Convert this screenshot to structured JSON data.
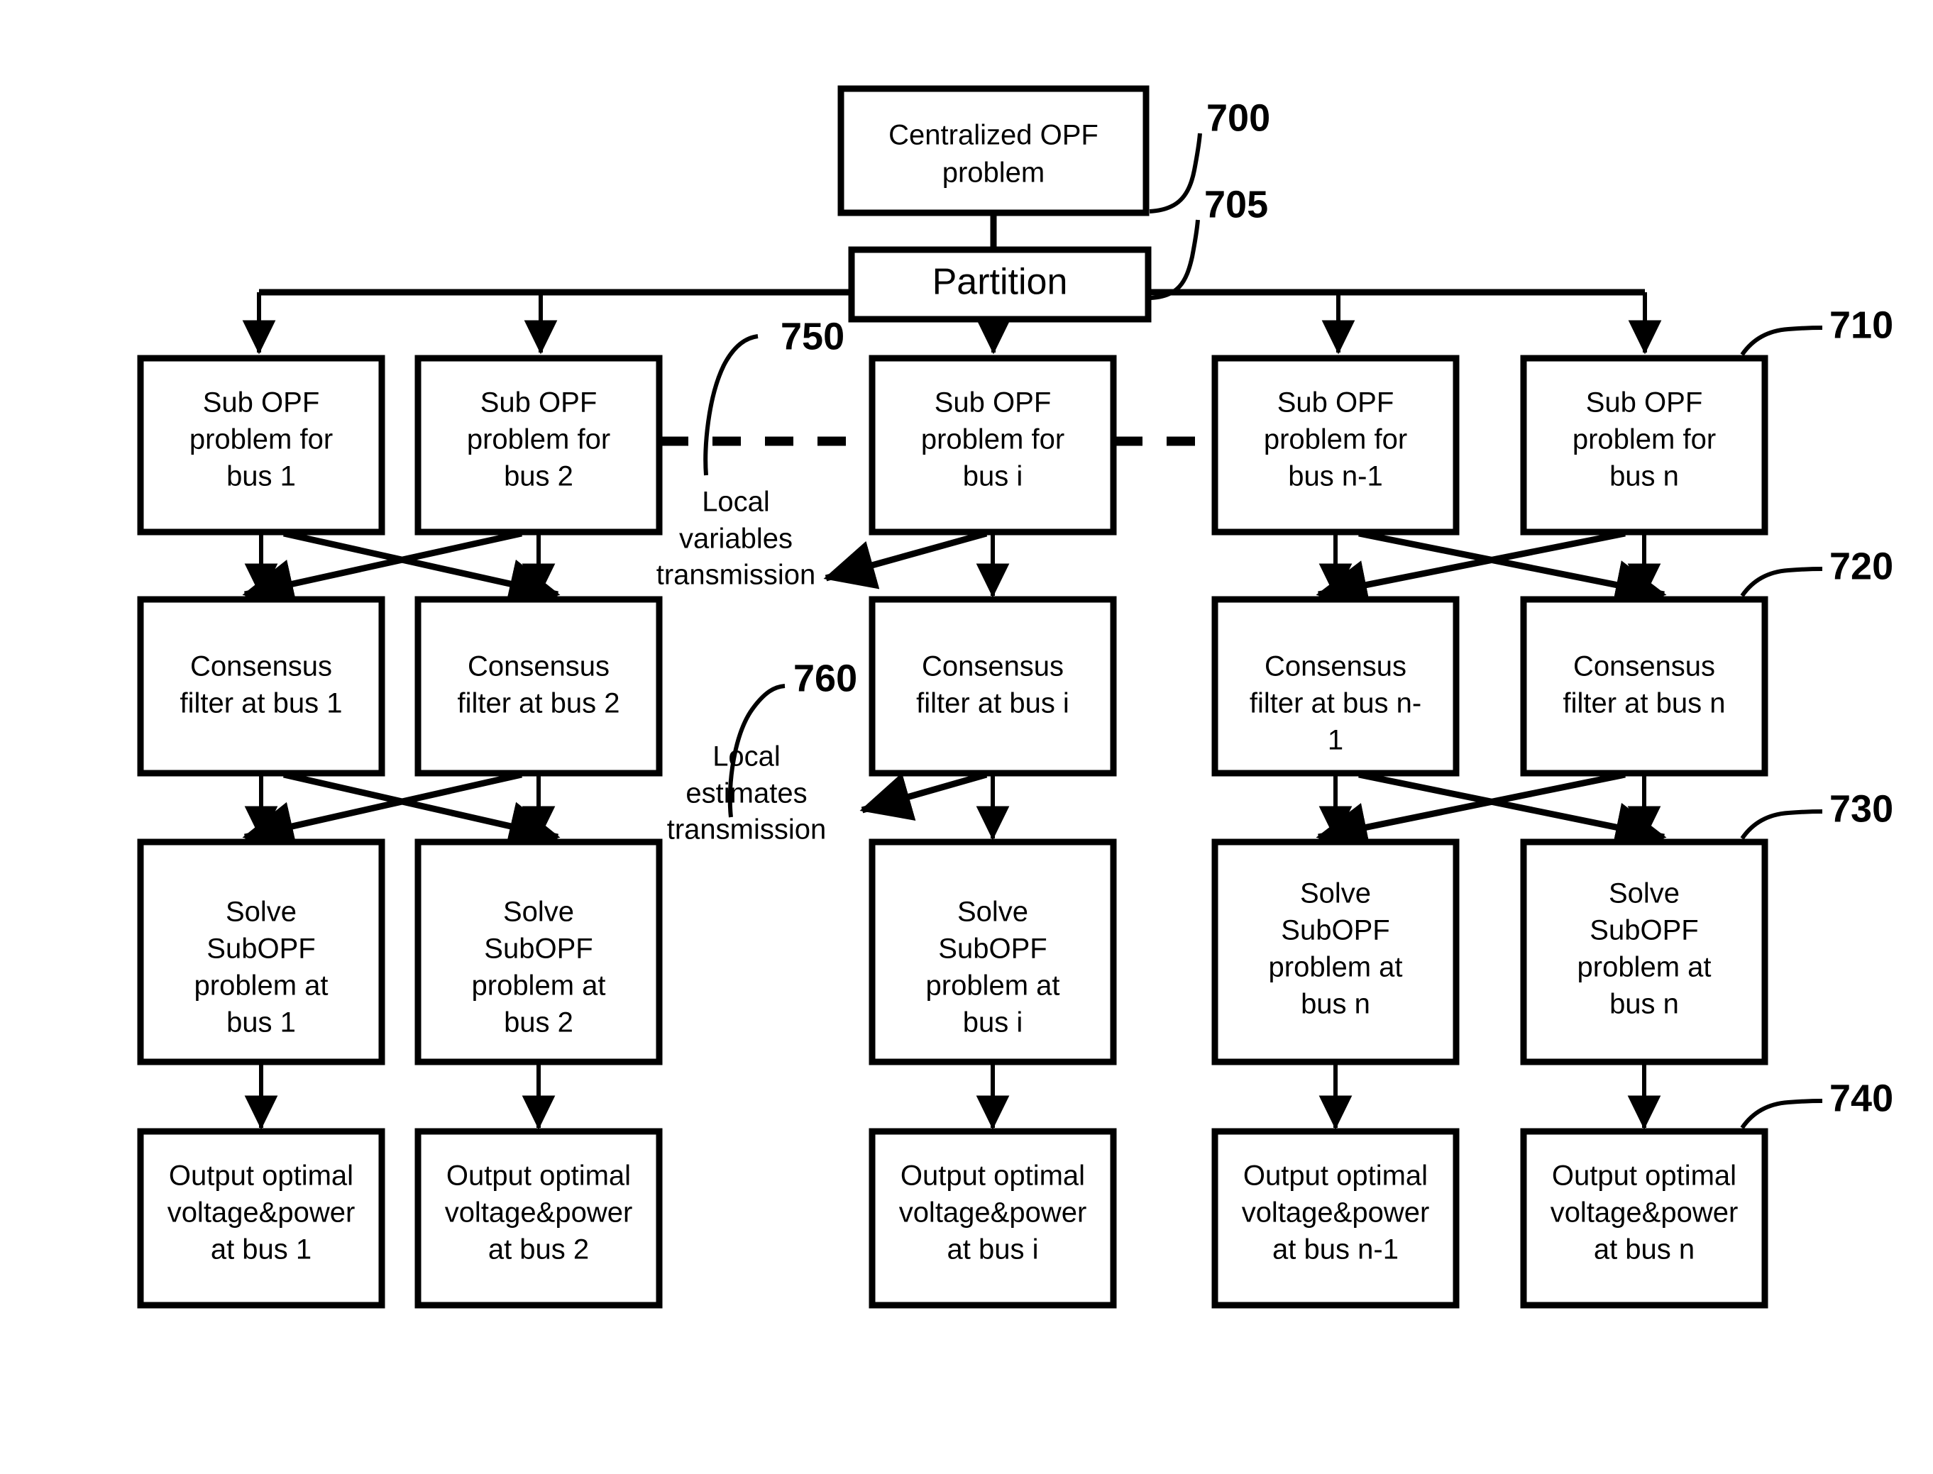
{
  "figure": {
    "title": "Distributed OPF flow diagram",
    "background_color": "#ffffff",
    "line_color": "#000000"
  },
  "nodes": {
    "centralized": {
      "ref": "700",
      "lines": [
        "Centralized OPF",
        "problem"
      ]
    },
    "partition": {
      "ref": "705",
      "lines": [
        "Partition"
      ]
    },
    "row_subopf": {
      "ref": "710",
      "items": [
        {
          "lines": [
            "Sub OPF",
            "problem for",
            "bus 1"
          ]
        },
        {
          "lines": [
            "Sub OPF",
            "problem for",
            "bus 2"
          ]
        },
        {
          "lines": [
            "Sub OPF",
            "problem for",
            "bus i"
          ]
        },
        {
          "lines": [
            "Sub OPF",
            "problem for",
            "bus n-1"
          ]
        },
        {
          "lines": [
            "Sub OPF",
            "problem for",
            "bus n"
          ]
        }
      ]
    },
    "row_consensus": {
      "ref": "720",
      "items": [
        {
          "lines": [
            "Consensus",
            "filter at bus 1"
          ]
        },
        {
          "lines": [
            "Consensus",
            "filter at bus 2"
          ]
        },
        {
          "lines": [
            "Consensus",
            "filter at bus i"
          ]
        },
        {
          "lines": [
            "Consensus",
            "filter at bus n-",
            "1"
          ]
        },
        {
          "lines": [
            "Consensus",
            "filter at bus n"
          ]
        }
      ]
    },
    "row_solve": {
      "ref": "730",
      "items": [
        {
          "lines": [
            "Solve",
            "SubOPF",
            "problem at",
            "bus 1"
          ]
        },
        {
          "lines": [
            "Solve",
            "SubOPF",
            "problem at",
            "bus 2"
          ]
        },
        {
          "lines": [
            "Solve",
            "SubOPF",
            "problem at",
            "bus i"
          ]
        },
        {
          "lines": [
            "Solve",
            "SubOPF",
            "problem at",
            "bus n"
          ]
        },
        {
          "lines": [
            "Solve",
            "SubOPF",
            "problem at",
            "bus n"
          ]
        }
      ]
    },
    "row_output": {
      "ref": "740",
      "items": [
        {
          "lines": [
            "Output optimal",
            "voltage&power",
            "at bus 1"
          ]
        },
        {
          "lines": [
            "Output optimal",
            "voltage&power",
            "at bus 2"
          ]
        },
        {
          "lines": [
            "Output optimal",
            "voltage&power",
            "at bus i"
          ]
        },
        {
          "lines": [
            "Output optimal",
            "voltage&power",
            "at bus n-1"
          ]
        },
        {
          "lines": [
            "Output optimal",
            "voltage&power",
            "at bus n"
          ]
        }
      ]
    }
  },
  "annotations": {
    "local_variables": {
      "ref": "750",
      "lines": [
        "Local",
        "variables",
        "transmission"
      ]
    },
    "local_estimates": {
      "ref": "760",
      "lines": [
        "Local",
        "estimates",
        "transmission"
      ]
    }
  },
  "ref_numbers": {
    "n700": "700",
    "n705": "705",
    "n710": "710",
    "n720": "720",
    "n730": "730",
    "n740": "740",
    "n750": "750",
    "n760": "760"
  }
}
